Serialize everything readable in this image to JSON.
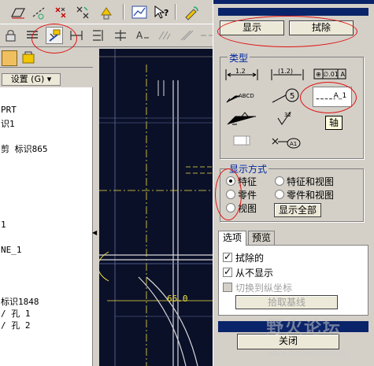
{
  "tree": {
    "settings_label": "设置 (G) ▾",
    "lines": [
      "PRT",
      "识1",
      "",
      "剪 标识865",
      "",
      "",
      "",
      "",
      "1",
      "",
      "",
      "NE_1",
      "",
      "",
      "",
      "",
      "标识1848",
      "/ 孔 1",
      "/ 孔 2"
    ]
  },
  "canvas": {
    "dimension_value": "66.0"
  },
  "dialog": {
    "show_label": "显示",
    "erase_label": "拭除",
    "type_title": "类型",
    "type_icons": [
      "dimension-icon",
      "reference-dimension-icon",
      "geometric-tolerance-icon",
      "note-icon",
      "balloon-note-icon",
      "surface-finish-icon",
      "welding-symbol-icon",
      "feature-datum-icon",
      "datum-axis-icon",
      "cosmetic-feature-icon",
      "datum-target-icon"
    ],
    "axis_tooltip": "轴",
    "mode_title": "显示方式",
    "modes": [
      {
        "label": "特征",
        "selected": true
      },
      {
        "label": "零件",
        "selected": false
      },
      {
        "label": "视图",
        "selected": false
      },
      {
        "label": "特征和视图",
        "selected": false
      },
      {
        "label": "零件和视图",
        "selected": false
      }
    ],
    "show_all_label": "显示全部",
    "tabs": [
      {
        "label": "选项"
      },
      {
        "label": "预览"
      }
    ],
    "options": [
      {
        "label": "拭除的",
        "checked": true,
        "enabled": true
      },
      {
        "label": "从不显示",
        "checked": true,
        "enabled": true
      },
      {
        "label": "切换到纵坐标",
        "checked": false,
        "enabled": false
      }
    ],
    "pick_baseline_label": "拾取基线",
    "close_label": "关闭"
  },
  "watermark": {
    "text": "野火论坛",
    "url": "www.proewildfire.cn"
  },
  "colors": {
    "canvas_bg": "#0b1029",
    "dialog_band": "#0a246a",
    "group_title": "#0026a0",
    "annotation_ring": "#e01010"
  }
}
